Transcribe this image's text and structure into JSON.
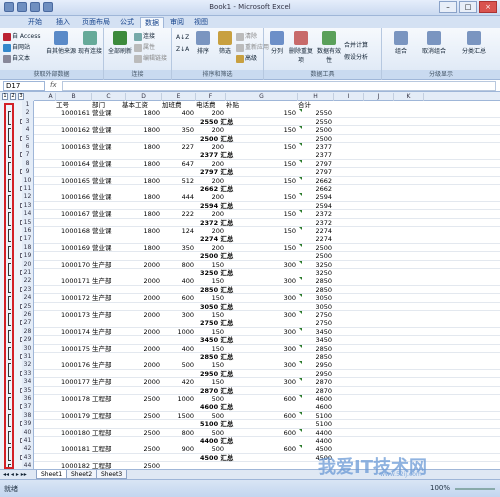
{
  "window": {
    "title": "Book1 - Microsoft Excel"
  },
  "ribbon_tabs": [
    "开始",
    "插入",
    "页面布局",
    "公式",
    "数据",
    "审阅",
    "视图"
  ],
  "active_tab": "数据",
  "ribbon": {
    "external": {
      "access": "自 Access",
      "web": "自网站",
      "text": "自文本",
      "other": "自其他来源",
      "existing": "现有连接",
      "group": "获取外部数据"
    },
    "connections": {
      "refresh": "全部刷新",
      "conn": "连接",
      "props": "属性",
      "links": "编辑链接",
      "group": "连接"
    },
    "sort": {
      "sort": "排序",
      "filter": "筛选",
      "clear": "清除",
      "reapply": "重新应用",
      "advanced": "高级",
      "group": "排序和筛选"
    },
    "tools": {
      "split": "分列",
      "dedupe": "删除重复项",
      "validate": "数据有效性",
      "consolidate": "合并计算",
      "whatif": "假设分析",
      "group": "数据工具"
    },
    "outline": {
      "groupbtn": "组合",
      "ungroup": "取消组合",
      "subtotal": "分类汇总",
      "group": "分级显示"
    }
  },
  "formula_bar": {
    "name_box": "D17",
    "fx": "fx",
    "value": ""
  },
  "outline_levels": [
    "1",
    "2",
    "3"
  ],
  "columns": [
    "A",
    "B",
    "C",
    "D",
    "E",
    "F",
    "G",
    "H",
    "I",
    "J",
    "K"
  ],
  "headers": [
    "工号",
    "部门",
    "基本工资",
    "加班费",
    "电话费",
    "补贴",
    "合计"
  ],
  "rows": [
    {
      "n": "1",
      "type": "header"
    },
    {
      "n": "2",
      "id": "1000161",
      "dept": "营业课",
      "base": "1800",
      "ot": "400",
      "phone": "200",
      "sub": "150",
      "total": "2550"
    },
    {
      "n": "3",
      "type": "sum",
      "label": "2550 汇总",
      "total": "2550"
    },
    {
      "n": "4",
      "id": "1000162",
      "dept": "营业课",
      "base": "1800",
      "ot": "350",
      "phone": "200",
      "sub": "150",
      "total": "2500"
    },
    {
      "n": "5",
      "type": "sum",
      "label": "2500 汇总",
      "total": "2500"
    },
    {
      "n": "6",
      "id": "1000163",
      "dept": "营业课",
      "base": "1800",
      "ot": "227",
      "phone": "200",
      "sub": "150",
      "total": "2377"
    },
    {
      "n": "7",
      "type": "sum",
      "label": "2377 汇总",
      "total": "2377"
    },
    {
      "n": "8",
      "id": "1000164",
      "dept": "营业课",
      "base": "1800",
      "ot": "647",
      "phone": "200",
      "sub": "150",
      "total": "2797"
    },
    {
      "n": "9",
      "type": "sum",
      "label": "2797 汇总",
      "total": "2797"
    },
    {
      "n": "10",
      "id": "1000165",
      "dept": "营业课",
      "base": "1800",
      "ot": "512",
      "phone": "200",
      "sub": "150",
      "total": "2662"
    },
    {
      "n": "11",
      "type": "sum",
      "label": "2662 汇总",
      "total": "2662"
    },
    {
      "n": "12",
      "id": "1000166",
      "dept": "营业课",
      "base": "1800",
      "ot": "444",
      "phone": "200",
      "sub": "150",
      "total": "2594"
    },
    {
      "n": "13",
      "type": "sum",
      "label": "2594 汇总",
      "total": "2594"
    },
    {
      "n": "14",
      "id": "1000167",
      "dept": "营业课",
      "base": "1800",
      "ot": "222",
      "phone": "200",
      "sub": "150",
      "total": "2372"
    },
    {
      "n": "15",
      "type": "sum",
      "label": "2372 汇总",
      "total": "2372"
    },
    {
      "n": "16",
      "id": "1000168",
      "dept": "营业课",
      "base": "1800",
      "ot": "124",
      "phone": "200",
      "sub": "150",
      "total": "2274"
    },
    {
      "n": "17",
      "type": "sum",
      "label": "2274 汇总",
      "total": "2274"
    },
    {
      "n": "18",
      "id": "1000169",
      "dept": "营业课",
      "base": "1800",
      "ot": "350",
      "phone": "200",
      "sub": "150",
      "total": "2500"
    },
    {
      "n": "19",
      "type": "sum",
      "label": "2500 汇总",
      "total": "2500"
    },
    {
      "n": "20",
      "id": "1000170",
      "dept": "生产部",
      "base": "2000",
      "ot": "800",
      "phone": "150",
      "sub": "300",
      "total": "3250"
    },
    {
      "n": "21",
      "type": "sum",
      "label": "3250 汇总",
      "total": "3250"
    },
    {
      "n": "22",
      "id": "1000171",
      "dept": "生产部",
      "base": "2000",
      "ot": "400",
      "phone": "150",
      "sub": "300",
      "total": "2850"
    },
    {
      "n": "23",
      "type": "sum",
      "label": "2850 汇总",
      "total": "2850"
    },
    {
      "n": "24",
      "id": "1000172",
      "dept": "生产部",
      "base": "2000",
      "ot": "600",
      "phone": "150",
      "sub": "300",
      "total": "3050"
    },
    {
      "n": "25",
      "type": "sum",
      "label": "3050 汇总",
      "total": "3050"
    },
    {
      "n": "26",
      "id": "1000173",
      "dept": "生产部",
      "base": "2000",
      "ot": "300",
      "phone": "150",
      "sub": "300",
      "total": "2750"
    },
    {
      "n": "27",
      "type": "sum",
      "label": "2750 汇总",
      "total": "2750"
    },
    {
      "n": "28",
      "id": "1000174",
      "dept": "生产部",
      "base": "2000",
      "ot": "1000",
      "phone": "150",
      "sub": "300",
      "total": "3450"
    },
    {
      "n": "29",
      "type": "sum",
      "label": "3450 汇总",
      "total": "3450"
    },
    {
      "n": "30",
      "id": "1000175",
      "dept": "生产部",
      "base": "2000",
      "ot": "400",
      "phone": "150",
      "sub": "300",
      "total": "2850"
    },
    {
      "n": "31",
      "type": "sum",
      "label": "2850 汇总",
      "total": "2850"
    },
    {
      "n": "32",
      "id": "1000176",
      "dept": "生产部",
      "base": "2000",
      "ot": "500",
      "phone": "150",
      "sub": "300",
      "total": "2950"
    },
    {
      "n": "33",
      "type": "sum",
      "label": "2950 汇总",
      "total": "2950"
    },
    {
      "n": "34",
      "id": "1000177",
      "dept": "生产部",
      "base": "2000",
      "ot": "420",
      "phone": "150",
      "sub": "300",
      "total": "2870"
    },
    {
      "n": "35",
      "type": "sum",
      "label": "2870 汇总",
      "total": "2870"
    },
    {
      "n": "36",
      "id": "1000178",
      "dept": "工程部",
      "base": "2500",
      "ot": "1000",
      "phone": "500",
      "sub": "600",
      "total": "4600"
    },
    {
      "n": "37",
      "type": "sum",
      "label": "4600 汇总",
      "total": "4600"
    },
    {
      "n": "38",
      "id": "1000179",
      "dept": "工程部",
      "base": "2500",
      "ot": "1500",
      "phone": "500",
      "sub": "600",
      "total": "5100"
    },
    {
      "n": "39",
      "type": "sum",
      "label": "5100 汇总",
      "total": "5100"
    },
    {
      "n": "40",
      "id": "1000180",
      "dept": "工程部",
      "base": "2500",
      "ot": "800",
      "phone": "500",
      "sub": "600",
      "total": "4400"
    },
    {
      "n": "41",
      "type": "sum",
      "label": "4400 汇总",
      "total": "4400"
    },
    {
      "n": "42",
      "id": "1000181",
      "dept": "工程部",
      "base": "2500",
      "ot": "900",
      "phone": "500",
      "sub": "600",
      "total": "4500"
    },
    {
      "n": "43",
      "type": "sum",
      "label": "4500 汇总",
      "total": "4500"
    },
    {
      "n": "44",
      "id": "1000182",
      "dept": "工程部",
      "base": "2500",
      "ot": "",
      "phone": "",
      "sub": "",
      "total": ""
    }
  ],
  "sheets": [
    "Sheet1",
    "Sheet2",
    "Sheet3"
  ],
  "status": {
    "ready": "就绪",
    "zoom": "100%"
  },
  "watermark": {
    "main": "我爱IT技术网",
    "sub": "www.52ij.com"
  }
}
